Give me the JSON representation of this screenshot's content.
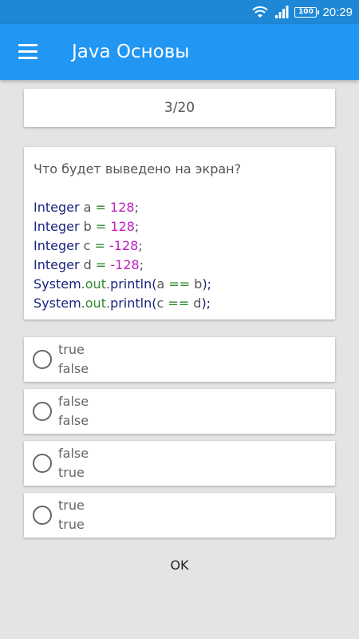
{
  "status_bar": {
    "time": "20:29",
    "battery": "100"
  },
  "app_bar": {
    "title": "Java Основы"
  },
  "progress": {
    "text": "3/20"
  },
  "question": {
    "prompt": "Что будет выведено на экран?",
    "code": {
      "line1": {
        "type": "Integer",
        "name": " a ",
        "op": "=",
        "value": " 128",
        "end": ";"
      },
      "line2": {
        "type": "Integer",
        "name": " b ",
        "op": "=",
        "value": " 128",
        "end": ";"
      },
      "line3": {
        "type": "Integer",
        "name": " c ",
        "op": "=",
        "value": " -128",
        "end": ";"
      },
      "line4": {
        "type": "Integer",
        "name": " d ",
        "op": "=",
        "value": " -128",
        "end": ";"
      },
      "line5": {
        "obj": "System",
        "dot1": ".",
        "field": "out",
        "dot2": ".",
        "method": "println(",
        "left": "a ",
        "op": "==",
        "right": " b",
        "close": ");"
      },
      "line6": {
        "obj": "System",
        "dot1": ".",
        "field": "out",
        "dot2": ".",
        "method": "println(",
        "left": "c ",
        "op": "==",
        "right": " d",
        "close": ");"
      }
    }
  },
  "options": [
    {
      "line1": "true",
      "line2": "false"
    },
    {
      "line1": "false",
      "line2": "false"
    },
    {
      "line1": "false",
      "line2": "true"
    },
    {
      "line1": "true",
      "line2": "true"
    }
  ],
  "ok_button": {
    "label": "OK"
  },
  "colors": {
    "status_bar": "#1e88d6",
    "app_bar": "#2196f3",
    "background": "#e4e4e4",
    "keyword": "#1a237e",
    "number": "#c01fc0",
    "operator": "#2e8b2e"
  }
}
